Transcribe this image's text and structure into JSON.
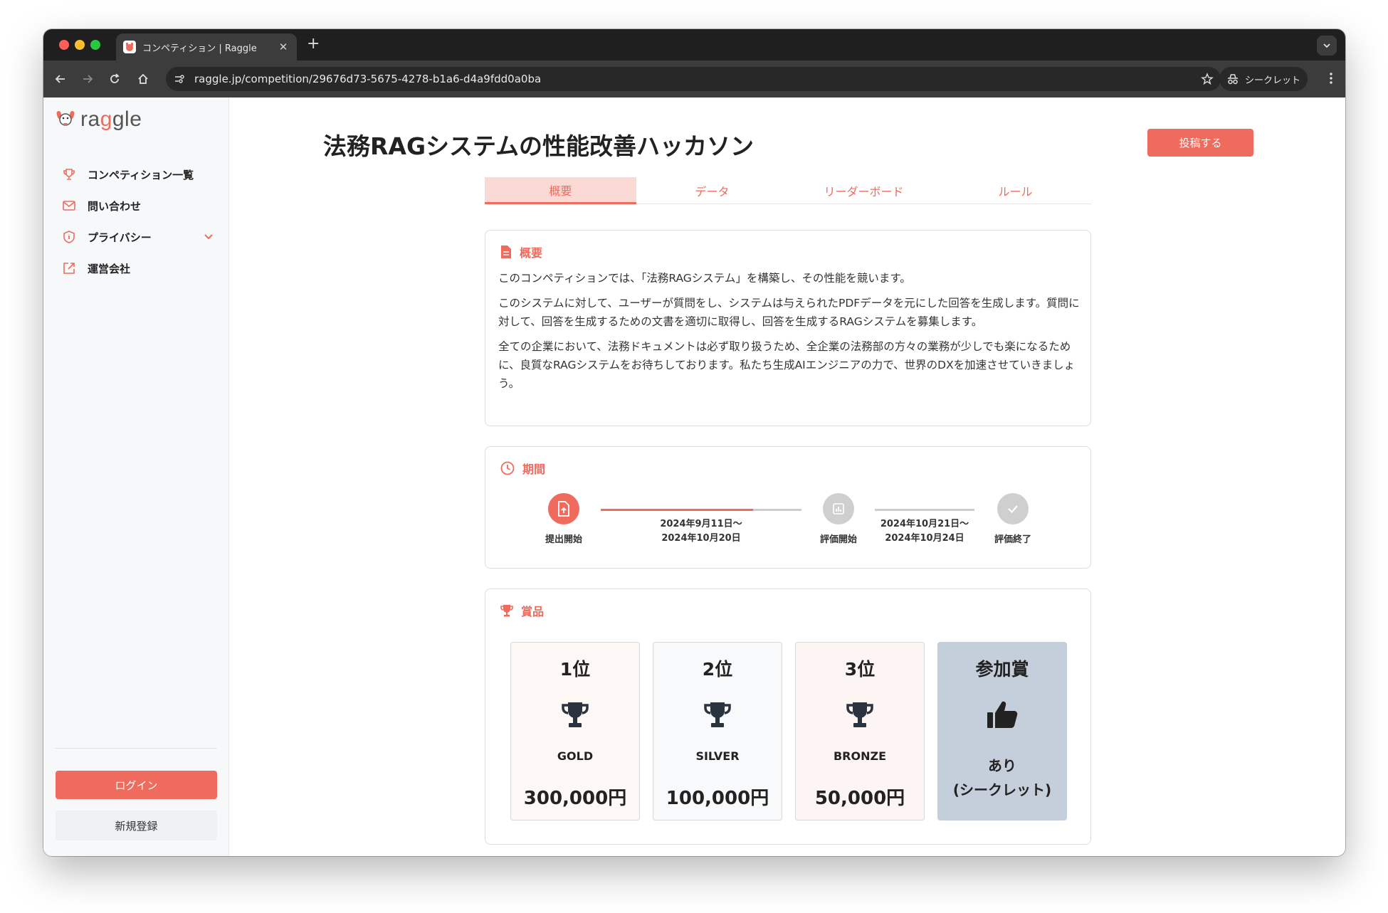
{
  "browser": {
    "tab_title": "コンペティション | Raggle",
    "url": "raggle.jp/competition/29676d73-5675-4278-b1a6-d4a9fdd0a0ba",
    "incognito_label": "シークレット"
  },
  "sidebar": {
    "logo_prefix": "ra",
    "logo_accent": "g",
    "logo_suffix": "gle",
    "items": [
      {
        "label": "コンペティション一覧",
        "icon": "trophy-icon"
      },
      {
        "label": "問い合わせ",
        "icon": "mail-icon"
      },
      {
        "label": "プライバシー",
        "icon": "shield-icon"
      },
      {
        "label": "運営会社",
        "icon": "external-link-icon"
      }
    ],
    "login_label": "ログイン",
    "signup_label": "新規登録"
  },
  "main": {
    "title": "法務RAGシステムの性能改善ハッカソン",
    "submit_label": "投稿する",
    "tabs": [
      "概要",
      "データ",
      "リーダーボード",
      "ルール"
    ],
    "overview": {
      "heading": "概要",
      "paragraphs": [
        "このコンペティションでは、「法務RAGシステム」を構築し、その性能を競います。",
        "このシステムに対して、ユーザーが質問をし、システムは与えられたPDFデータを元にした回答を生成します。質問に対して、回答を生成するための文書を適切に取得し、回答を生成するRAGシステムを募集します。",
        "全ての企業において、法務ドキュメントは必ず取り扱うため、全企業の法務部の方々の業務が少しでも楽になるために、良質なRAGシステムをお待ちしております。私たち生成AIエンジニアの力で、世界のDXを加速させていきましょう。"
      ]
    },
    "period": {
      "heading": "期間",
      "steps": [
        "提出開始",
        "評価開始",
        "評価終了"
      ],
      "range1": {
        "start": "2024年9月11日〜",
        "end": "2024年10月20日"
      },
      "range2": {
        "start": "2024年10月21日〜",
        "end": "2024年10月24日"
      },
      "progress1": 0.76,
      "progress2": 0.0
    },
    "prizes": {
      "heading": "賞品",
      "items": [
        {
          "rank": "1位",
          "tier": "GOLD",
          "amount": "300,000円",
          "bg": "#fdf8f5"
        },
        {
          "rank": "2位",
          "tier": "SILVER",
          "amount": "100,000円",
          "bg": "#f8f9fb"
        },
        {
          "rank": "3位",
          "tier": "BRONZE",
          "amount": "50,000円",
          "bg": "#fdf5f4"
        },
        {
          "rank": "参加賞",
          "line1": "あり",
          "line2": "(シークレット)",
          "bg": "#c5cfdb"
        }
      ]
    }
  },
  "colors": {
    "accent": "#ef6b5e",
    "muted": "#cccccc"
  }
}
